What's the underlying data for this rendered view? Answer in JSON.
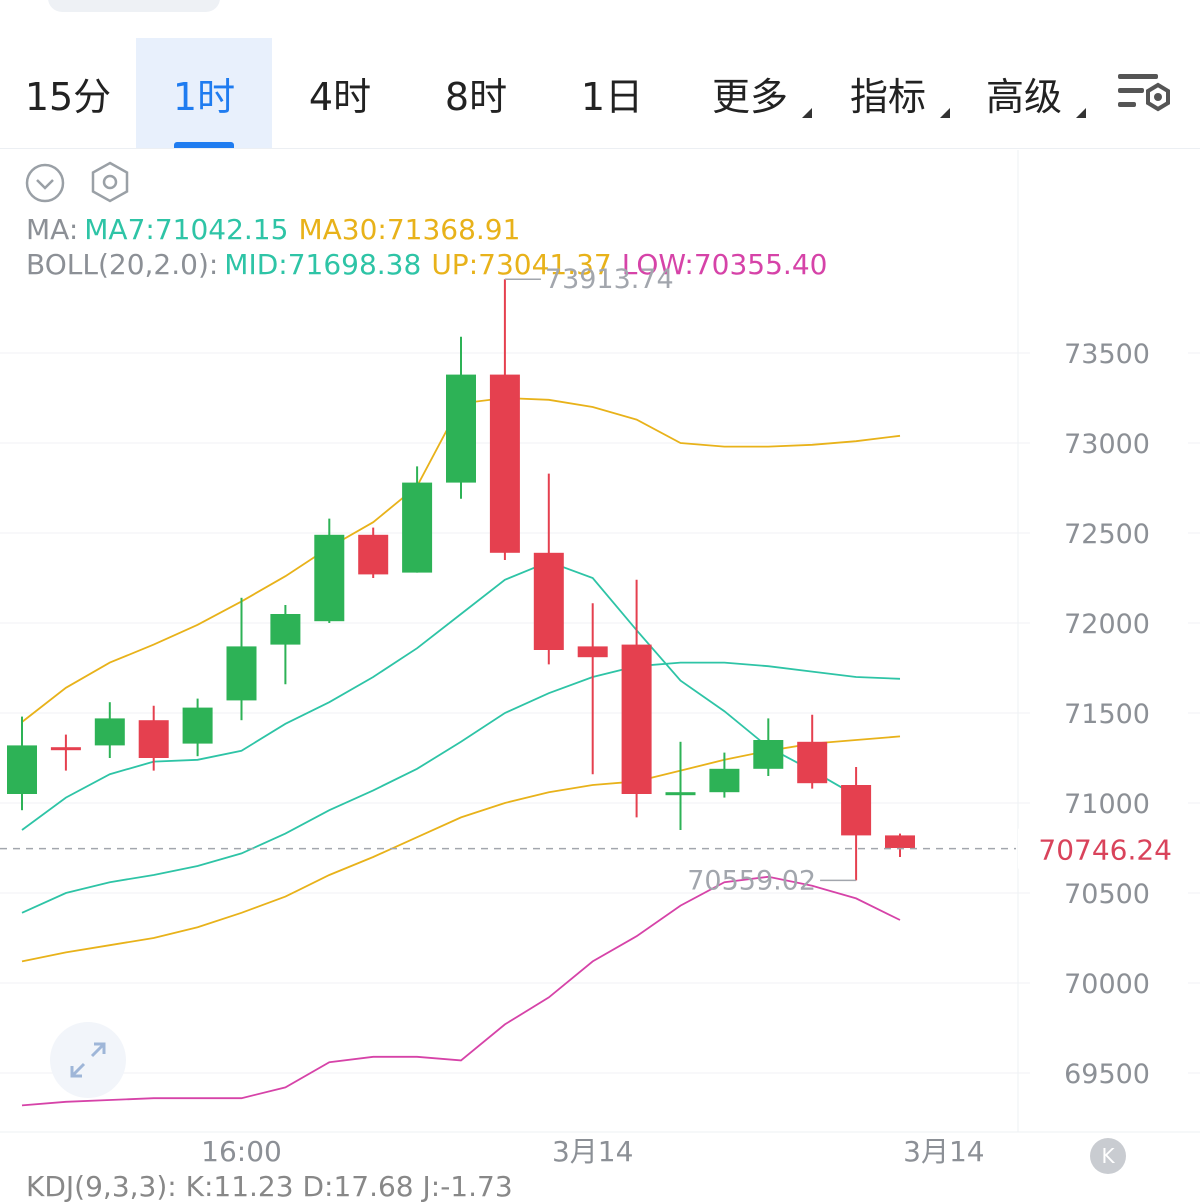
{
  "tabs": [
    {
      "label": "15分"
    },
    {
      "label": "1时"
    },
    {
      "label": "4时"
    },
    {
      "label": "8时"
    },
    {
      "label": "1日"
    },
    {
      "label": "更多"
    },
    {
      "label": "指标"
    },
    {
      "label": "高级"
    }
  ],
  "active_tab": "1时",
  "indicators": {
    "ma_label": "MA:",
    "ma7": "MA7:71042.15",
    "ma30": "MA30:71368.91",
    "boll_label": "BOLL(20,2.0):",
    "boll_mid": "MID:71698.38",
    "boll_up": "UP:73041.37",
    "boll_low": "LOW:70355.40"
  },
  "kdj_peek": "KDJ(9,3,3): K:11.23 D:17.68 J:-1.73",
  "colors": {
    "up": "#2db256",
    "down": "#e5404f",
    "ma7": "#2ec4a6",
    "ma30": "#e8b21a",
    "boll_mid": "#2ec4a6",
    "boll_up": "#e8b21a",
    "boll_low": "#d643a8",
    "accent": "#1f7cf0"
  },
  "chart_data": {
    "type": "candlestick",
    "y_ticks": [
      73500,
      73000,
      72500,
      72000,
      71500,
      71000,
      70500,
      70000,
      69500
    ],
    "x_labels": [
      {
        "label": "16:00",
        "index": 5
      },
      {
        "label": "3月14",
        "index": 13
      },
      {
        "label": "3月14",
        "index": 21
      }
    ],
    "current_price": 70746.24,
    "max_annotation": "73913.74",
    "min_annotation": "70559.02",
    "candles": [
      {
        "o": 71050,
        "h": 71480,
        "l": 70960,
        "c": 71320
      },
      {
        "o": 71310,
        "h": 71380,
        "l": 71180,
        "c": 71300
      },
      {
        "o": 71320,
        "h": 71560,
        "l": 71250,
        "c": 71470
      },
      {
        "o": 71460,
        "h": 71540,
        "l": 71180,
        "c": 71250
      },
      {
        "o": 71330,
        "h": 71580,
        "l": 71260,
        "c": 71530
      },
      {
        "o": 71570,
        "h": 72140,
        "l": 71460,
        "c": 71870
      },
      {
        "o": 71880,
        "h": 72100,
        "l": 71660,
        "c": 72050
      },
      {
        "o": 72010,
        "h": 72580,
        "l": 72000,
        "c": 72490
      },
      {
        "o": 72490,
        "h": 72530,
        "l": 72250,
        "c": 72270
      },
      {
        "o": 72280,
        "h": 72870,
        "l": 72280,
        "c": 72780
      },
      {
        "o": 72780,
        "h": 73590,
        "l": 72690,
        "c": 73380
      },
      {
        "o": 73380,
        "h": 73910,
        "l": 72350,
        "c": 72390
      },
      {
        "o": 72390,
        "h": 72830,
        "l": 71770,
        "c": 71850
      },
      {
        "o": 71870,
        "h": 72110,
        "l": 71160,
        "c": 71810
      },
      {
        "o": 71880,
        "h": 72240,
        "l": 70920,
        "c": 71050
      },
      {
        "o": 71050,
        "h": 71340,
        "l": 70850,
        "c": 71060
      },
      {
        "o": 71060,
        "h": 71280,
        "l": 71030,
        "c": 71190
      },
      {
        "o": 71190,
        "h": 71470,
        "l": 71150,
        "c": 71350
      },
      {
        "o": 71340,
        "h": 71490,
        "l": 71080,
        "c": 71110
      },
      {
        "o": 71100,
        "h": 71200,
        "l": 70570,
        "c": 70820
      },
      {
        "o": 70820,
        "h": 70830,
        "l": 70700,
        "c": 70750
      }
    ],
    "series": [
      {
        "key": "ma7",
        "values": [
          70850,
          71030,
          71160,
          71230,
          71240,
          71290,
          71440,
          71560,
          71700,
          71860,
          72050,
          72240,
          72340,
          72250,
          71960,
          71680,
          71510,
          71310,
          71180,
          71040,
          null
        ]
      },
      {
        "key": "ma30",
        "values": [
          70120,
          70170,
          70210,
          70250,
          70310,
          70390,
          70480,
          70600,
          70700,
          70810,
          70920,
          71000,
          71060,
          71100,
          71120,
          71180,
          71240,
          71290,
          71330,
          71350,
          71370
        ]
      },
      {
        "key": "boll_mid",
        "values": [
          70390,
          70500,
          70560,
          70600,
          70650,
          70720,
          70830,
          70960,
          71070,
          71190,
          71340,
          71500,
          71610,
          71700,
          71760,
          71780,
          71780,
          71760,
          71730,
          71700,
          71690
        ]
      },
      {
        "key": "boll_up",
        "values": [
          71450,
          71640,
          71780,
          71880,
          71990,
          72120,
          72260,
          72420,
          72560,
          72760,
          73220,
          73250,
          73240,
          73200,
          73130,
          73000,
          72980,
          72980,
          72990,
          73010,
          73040
        ]
      },
      {
        "key": "boll_low",
        "values": [
          69320,
          69340,
          69350,
          69360,
          69360,
          69360,
          69420,
          69560,
          69590,
          69590,
          69570,
          69770,
          69920,
          70120,
          70260,
          70430,
          70560,
          70590,
          70540,
          70470,
          70350
        ]
      }
    ]
  }
}
